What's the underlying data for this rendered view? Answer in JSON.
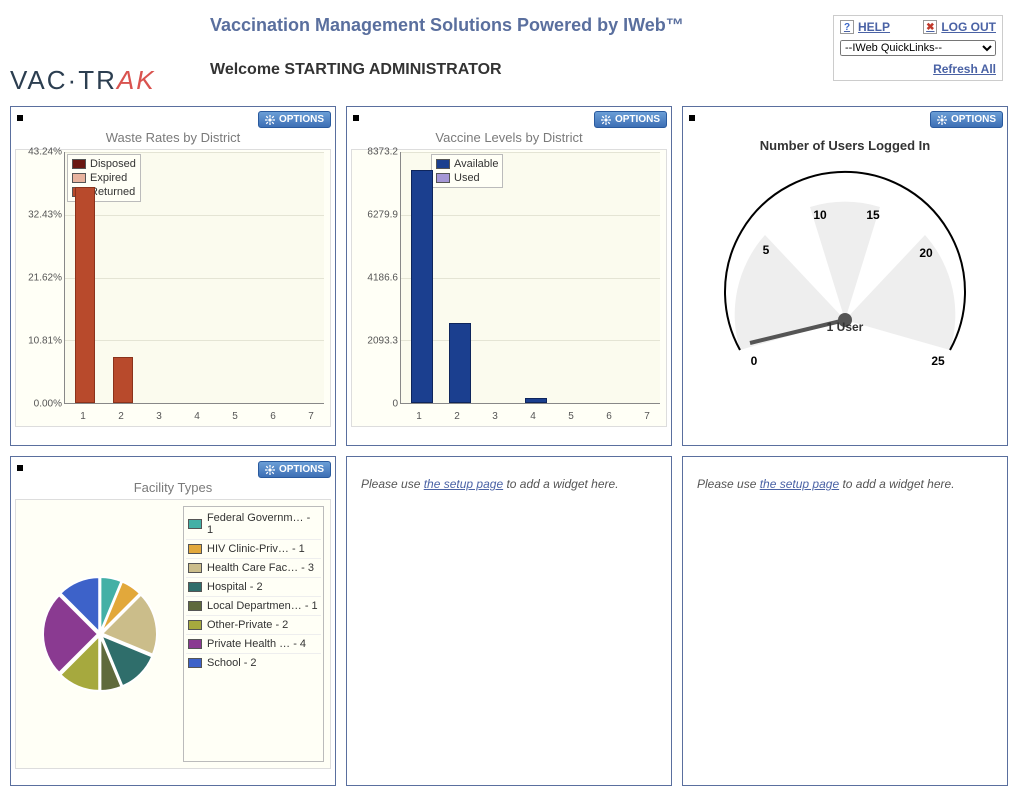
{
  "app_title": "Vaccination Management Solutions Powered by IWeb™",
  "welcome": "Welcome STARTING ADMINISTRATOR",
  "logo": {
    "text1": "VAC·TR",
    "text2": "AK"
  },
  "top_right": {
    "help": "HELP",
    "logout": "LOG OUT",
    "quicklinks_selected": "--IWeb QuickLinks--",
    "refresh_all": "Refresh All"
  },
  "options_label": "OPTIONS",
  "widgets": {
    "waste": {
      "title": "Waste Rates by District",
      "legend": [
        "Disposed",
        "Expired",
        "Returned"
      ],
      "legend_colors": [
        "#6a1812",
        "#e8b39e",
        "#b84a2c"
      ]
    },
    "levels": {
      "title": "Vaccine Levels by District",
      "legend": [
        "Available",
        "Used"
      ],
      "legend_colors": [
        "#1b3f8f",
        "#a597d6"
      ]
    },
    "gauge": {
      "title": "Number of Users Logged In",
      "value_label": "1 User"
    },
    "facility": {
      "title": "Facility Types",
      "rows": [
        {
          "label": "Federal Governm… - 1",
          "color": "#43b0a6"
        },
        {
          "label": "HIV Clinic-Priv… - 1",
          "color": "#e2a83b"
        },
        {
          "label": "Health Care Fac… - 3",
          "color": "#cbbd8a"
        },
        {
          "label": "Hospital - 2",
          "color": "#2f6e6b"
        },
        {
          "label": "Local Departmen… - 1",
          "color": "#5f6a3c"
        },
        {
          "label": "Other-Private - 2",
          "color": "#a6a93e"
        },
        {
          "label": "Private Health … - 4",
          "color": "#8a3a91"
        },
        {
          "label": "School - 2",
          "color": "#3d62c9"
        }
      ]
    },
    "empty": {
      "prefix": "Please use ",
      "link": "the setup page",
      "suffix": " to add a widget here."
    }
  },
  "chart_data": [
    {
      "type": "bar",
      "title": "Waste Rates by District",
      "categories": [
        "1",
        "2",
        "3",
        "4",
        "5",
        "6",
        "7"
      ],
      "series": [
        {
          "name": "Disposed",
          "values": [
            0,
            0,
            0,
            0,
            0,
            0,
            0
          ]
        },
        {
          "name": "Expired",
          "values": [
            0,
            0,
            0,
            0,
            0,
            0,
            0
          ]
        },
        {
          "name": "Returned",
          "values": [
            37.0,
            8.0,
            0,
            0,
            0,
            0,
            0
          ]
        }
      ],
      "xlabel": "",
      "ylabel": "",
      "ylim": [
        0,
        43.24
      ],
      "yticks": [
        "43.24%",
        "32.43%",
        "21.62%",
        "10.81%",
        "0.00%"
      ]
    },
    {
      "type": "bar",
      "title": "Vaccine Levels by District",
      "categories": [
        "1",
        "2",
        "3",
        "4",
        "5",
        "6",
        "7"
      ],
      "series": [
        {
          "name": "Available",
          "values": [
            7800,
            2700,
            0,
            150,
            0,
            0,
            0
          ]
        },
        {
          "name": "Used",
          "values": [
            0,
            0,
            0,
            0,
            0,
            0,
            0
          ]
        }
      ],
      "xlabel": "",
      "ylabel": "",
      "ylim": [
        0,
        8373.2
      ],
      "yticks": [
        "8373.2",
        "6279.9",
        "4186.6",
        "2093.3",
        "0"
      ]
    },
    {
      "type": "gauge",
      "title": "Number of Users Logged In",
      "value": 1,
      "min": 0,
      "max": 25,
      "ticks": [
        0,
        5,
        10,
        15,
        20,
        25
      ]
    },
    {
      "type": "pie",
      "title": "Facility Types",
      "series": [
        {
          "name": "Federal Government",
          "value": 1
        },
        {
          "name": "HIV Clinic-Private",
          "value": 1
        },
        {
          "name": "Health Care Facility",
          "value": 3
        },
        {
          "name": "Hospital",
          "value": 2
        },
        {
          "name": "Local Department",
          "value": 1
        },
        {
          "name": "Other-Private",
          "value": 2
        },
        {
          "name": "Private Health",
          "value": 4
        },
        {
          "name": "School",
          "value": 2
        }
      ]
    }
  ]
}
